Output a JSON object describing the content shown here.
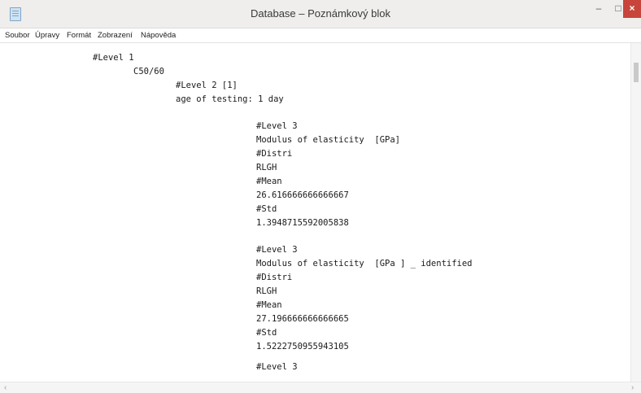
{
  "window": {
    "title": "Database – Poznámkový blok"
  },
  "controls": {
    "minimize": "–",
    "maximize": "□",
    "close": "×"
  },
  "menu": [
    "Soubor",
    "Úpravy",
    "Formát",
    "Zobrazení",
    "Nápověda"
  ],
  "lines": [
    "#Level 1",
    "C50/60",
    "#Level 2 [1]",
    "age of testing: 1 day",
    "#Level 3",
    "Modulus of elasticity  [GPa]",
    "#Distri",
    "RLGH",
    "#Mean",
    "26.616666666666667",
    "#Std",
    "1.3948715592005838",
    "#Level 3",
    "Modulus of elasticity  [GPa ] _ identified",
    "#Distri",
    "RLGH",
    "#Mean",
    "27.196666666666665",
    "#Std",
    "1.5222750955943105",
    "#Level 3"
  ],
  "scroll": {
    "left_arrow": "‹",
    "right_arrow": "›"
  }
}
